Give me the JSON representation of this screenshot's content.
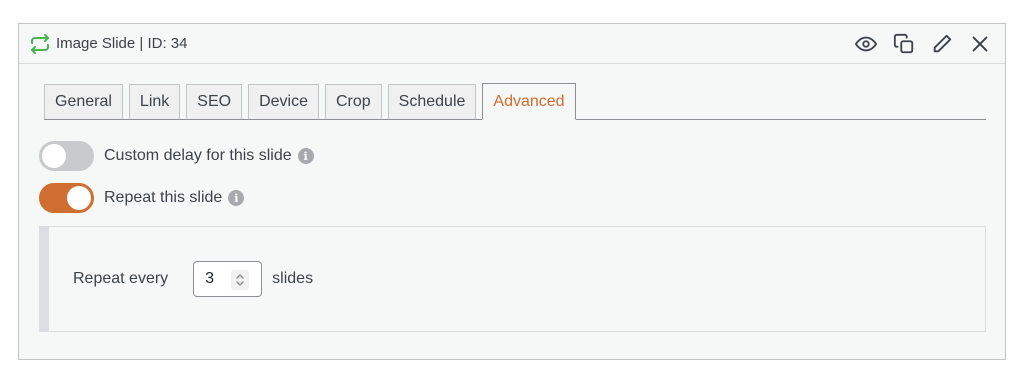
{
  "header": {
    "title": "Image Slide | ID: 34",
    "icon": "repeat-arrows-icon",
    "icon_color": "#46b450",
    "actions": [
      {
        "name": "preview-button",
        "icon": "eye-icon"
      },
      {
        "name": "duplicate-button",
        "icon": "copy-icon"
      },
      {
        "name": "edit-button",
        "icon": "pencil-icon"
      },
      {
        "name": "close-button",
        "icon": "close-icon"
      }
    ]
  },
  "tabs": [
    {
      "label": "General",
      "active": false
    },
    {
      "label": "Link",
      "active": false
    },
    {
      "label": "SEO",
      "active": false
    },
    {
      "label": "Device",
      "active": false
    },
    {
      "label": "Crop",
      "active": false
    },
    {
      "label": "Schedule",
      "active": false
    },
    {
      "label": "Advanced",
      "active": true
    }
  ],
  "settings": {
    "custom_delay": {
      "label": "Custom delay for this slide",
      "enabled": false
    },
    "repeat": {
      "label": "Repeat this slide",
      "enabled": true
    }
  },
  "repeat_options": {
    "label": "Repeat every",
    "value": "3",
    "unit": "slides"
  },
  "colors": {
    "accent": "#d06d30",
    "toggle_off": "#c9cacc"
  }
}
